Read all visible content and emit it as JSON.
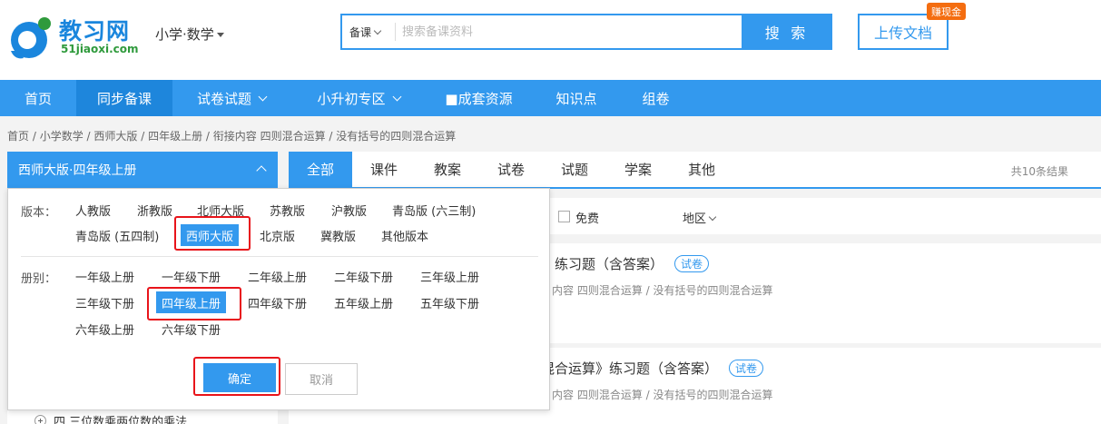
{
  "colors": {
    "primary": "#3399ee",
    "nav_active": "#1e86dc",
    "badge": "#f46d10",
    "highlight": "#e8141a",
    "logo_green": "#2f9a3c"
  },
  "header": {
    "logo_title": "教习网",
    "logo_sub": "51jiaoxi.com",
    "subject": "小学·数学",
    "search_type": "备课",
    "search_placeholder": "搜索备课资料",
    "search_button": "搜 索",
    "upload_button": "上传文档",
    "earn_badge": "赚现金"
  },
  "nav": {
    "items": [
      {
        "label": "首页"
      },
      {
        "label": "同步备课"
      },
      {
        "label": "试卷试题"
      },
      {
        "label": "小升初专区"
      },
      {
        "label": "■成套资源"
      },
      {
        "label": "知识点"
      },
      {
        "label": "组卷"
      }
    ]
  },
  "breadcrumb": [
    "首页",
    "小学数学",
    "西师大版",
    "四年级上册",
    "衔接内容 四则混合运算",
    "没有括号的四则混合运算"
  ],
  "left": {
    "version_selector": "西师大版·四年级上册",
    "tree_item": "四 三位数乘两位数的乘法"
  },
  "tabs": [
    {
      "label": "全部"
    },
    {
      "label": "课件"
    },
    {
      "label": "教案"
    },
    {
      "label": "试卷"
    },
    {
      "label": "试题"
    },
    {
      "label": "学案"
    },
    {
      "label": "其他"
    }
  ],
  "result_count": "共10条结果",
  "filter": {
    "free": "免费",
    "region": "地区"
  },
  "results": [
    {
      "title": "》练习题（含答案）",
      "tag": "试卷",
      "path": "内容 四则混合运算  /  没有括号的四则混合运算"
    },
    {
      "title": "混合运算》练习题（含答案）",
      "tag": "试卷",
      "path": "内容 四则混合运算  /  没有括号的四则混合运算"
    }
  ],
  "panel": {
    "version_label": "版本：",
    "versions": [
      "人教版",
      "浙教版",
      "北师大版",
      "苏教版",
      "沪教版",
      "青岛版 (六三制)",
      "青岛版 (五四制)",
      "西师大版",
      "北京版",
      "冀教版",
      "其他版本"
    ],
    "selected_version": "西师大版",
    "grade_label": "册别：",
    "grades": [
      "一年级上册",
      "一年级下册",
      "二年级上册",
      "二年级下册",
      "三年级上册",
      "三年级下册",
      "四年级上册",
      "四年级下册",
      "五年级上册",
      "五年级下册",
      "六年级上册",
      "六年级下册"
    ],
    "selected_grade": "四年级上册",
    "confirm": "确定",
    "cancel": "取消"
  }
}
